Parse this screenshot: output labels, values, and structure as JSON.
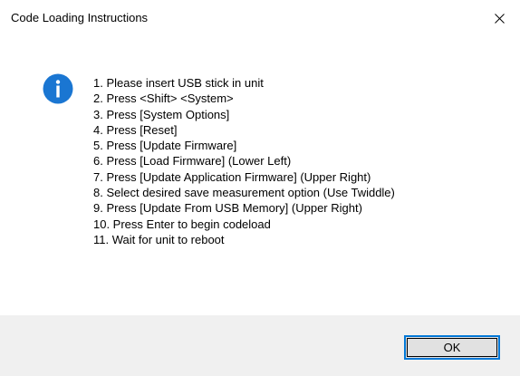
{
  "window": {
    "title": "Code Loading Instructions",
    "close_icon": "close-icon"
  },
  "message": {
    "icon": "info-icon",
    "lines": [
      "1. Please insert USB stick in unit",
      "2. Press <Shift> <System>",
      "3. Press [System Options]",
      "4. Press [Reset]",
      "5. Press [Update Firmware]",
      "6. Press [Load Firmware] (Lower Left)",
      "7. Press [Update Application Firmware] (Upper Right)",
      "8. Select desired save measurement option (Use Twiddle)",
      "9. Press [Update From USB Memory] (Upper Right)",
      "10. Press Enter to begin codeload",
      "11. Wait for unit to reboot"
    ]
  },
  "buttons": {
    "ok_label": "OK"
  },
  "colors": {
    "accent": "#0078d7",
    "footer_bg": "#f0f0f0",
    "button_bg": "#e1e1e1",
    "info_icon": "#1a76d2"
  }
}
